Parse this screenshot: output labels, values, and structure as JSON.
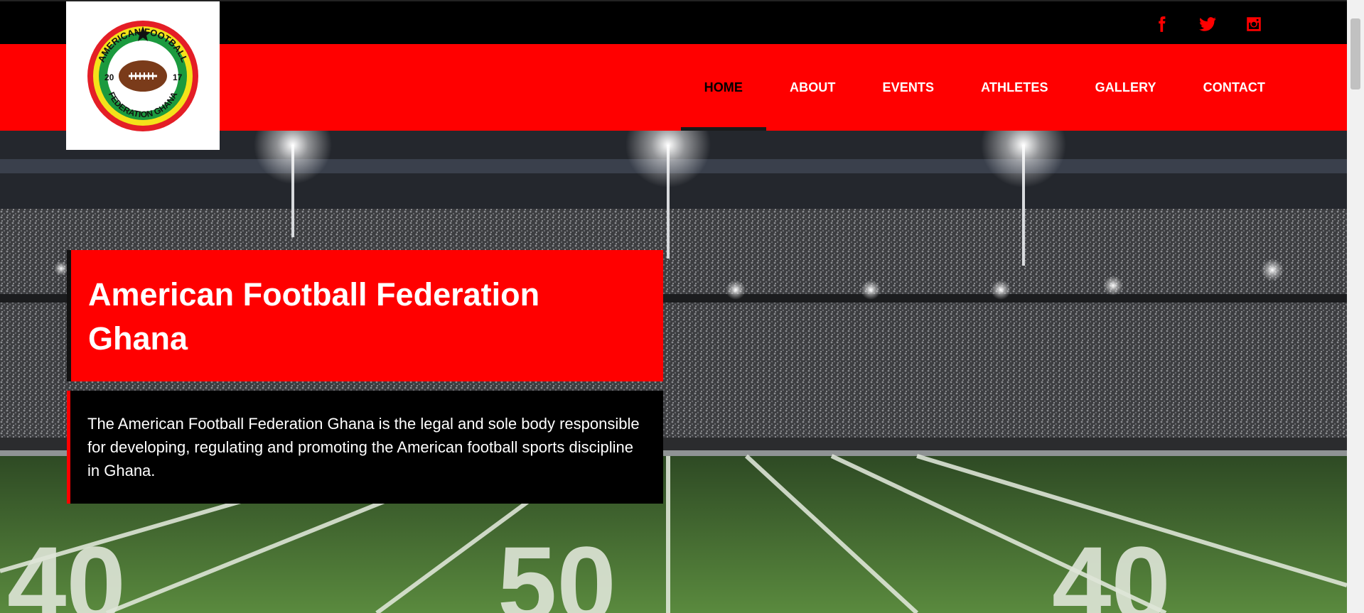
{
  "header": {
    "logo": {
      "top_text": "AMERICAN FOOTBALL",
      "bottom_text": "FEDERATION GHANA",
      "year_left": "20",
      "year_right": "17"
    },
    "social": [
      {
        "icon": "facebook-icon"
      },
      {
        "icon": "twitter-icon"
      },
      {
        "icon": "instagram-icon"
      }
    ],
    "nav": [
      {
        "label": "HOME",
        "active": true
      },
      {
        "label": "ABOUT",
        "active": false
      },
      {
        "label": "EVENTS",
        "active": false
      },
      {
        "label": "ATHLETES",
        "active": false
      },
      {
        "label": "GALLERY",
        "active": false
      },
      {
        "label": "CONTACT",
        "active": false
      }
    ]
  },
  "hero": {
    "title": "American Football Federation Ghana",
    "description": "The American Football Federation Ghana is the legal and sole body responsible for developing, regulating and promoting the American football sports discipline in Ghana.",
    "field_numbers": [
      "40",
      "50",
      "40"
    ]
  },
  "colors": {
    "accent": "#ff0000",
    "bar": "#000000",
    "active_nav_text": "#000000"
  }
}
